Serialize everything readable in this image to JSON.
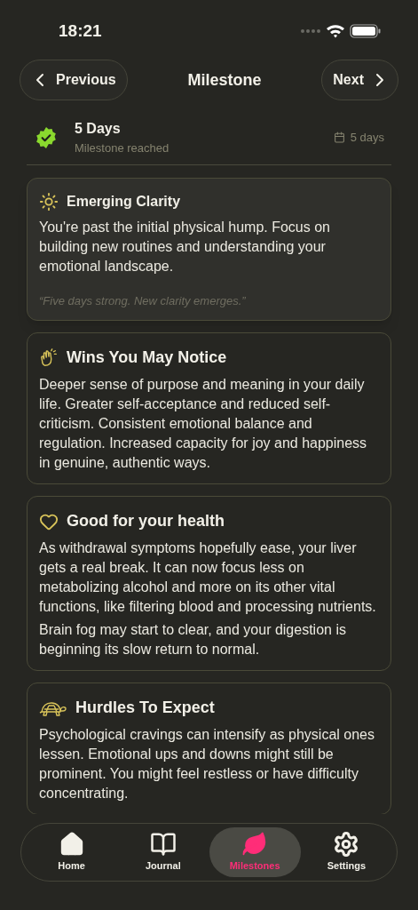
{
  "status_bar": {
    "time": "18:21"
  },
  "header": {
    "back_button": "Previous",
    "title": "Milestone",
    "next_button": "Next"
  },
  "milestone": {
    "title": "5 Days",
    "subtitle": "Milestone reached",
    "duration": "5 days"
  },
  "sections": [
    {
      "kind": "highlight",
      "title": "Emerging Clarity",
      "paragraphs": [
        "You're past the initial physical hump. Focus on building new routines and understanding your emotional landscape."
      ],
      "quote": "“Five days strong. New clarity emerges.”"
    },
    {
      "kind": "section",
      "title": "Wins You May Notice",
      "paragraphs": [
        "Deeper sense of purpose and meaning in your daily life. Greater self-acceptance and reduced self-criticism. Consistent emotional balance and regulation. Increased capacity for joy and happiness in genuine, authentic ways."
      ]
    },
    {
      "kind": "section",
      "title": "Good for your health",
      "paragraphs": [
        "As withdrawal symptoms hopefully ease, your liver gets a real break. It can now focus less on metabolizing alcohol and more on its other vital functions, like filtering blood and processing nutrients.",
        "Brain fog may start to clear, and your digestion is beginning its slow return to normal."
      ]
    },
    {
      "kind": "section",
      "title": "Hurdles To Expect",
      "paragraphs": [
        "Psychological cravings can intensify as physical ones lessen. Emotional ups and downs might still be prominent. You might feel restless or have difficulty concentrating."
      ]
    }
  ],
  "tab_bar": [
    {
      "label": "Home",
      "selected": false
    },
    {
      "label": "Journal",
      "selected": false
    },
    {
      "label": "Milestones",
      "selected": true
    },
    {
      "label": "Settings",
      "selected": false
    }
  ]
}
